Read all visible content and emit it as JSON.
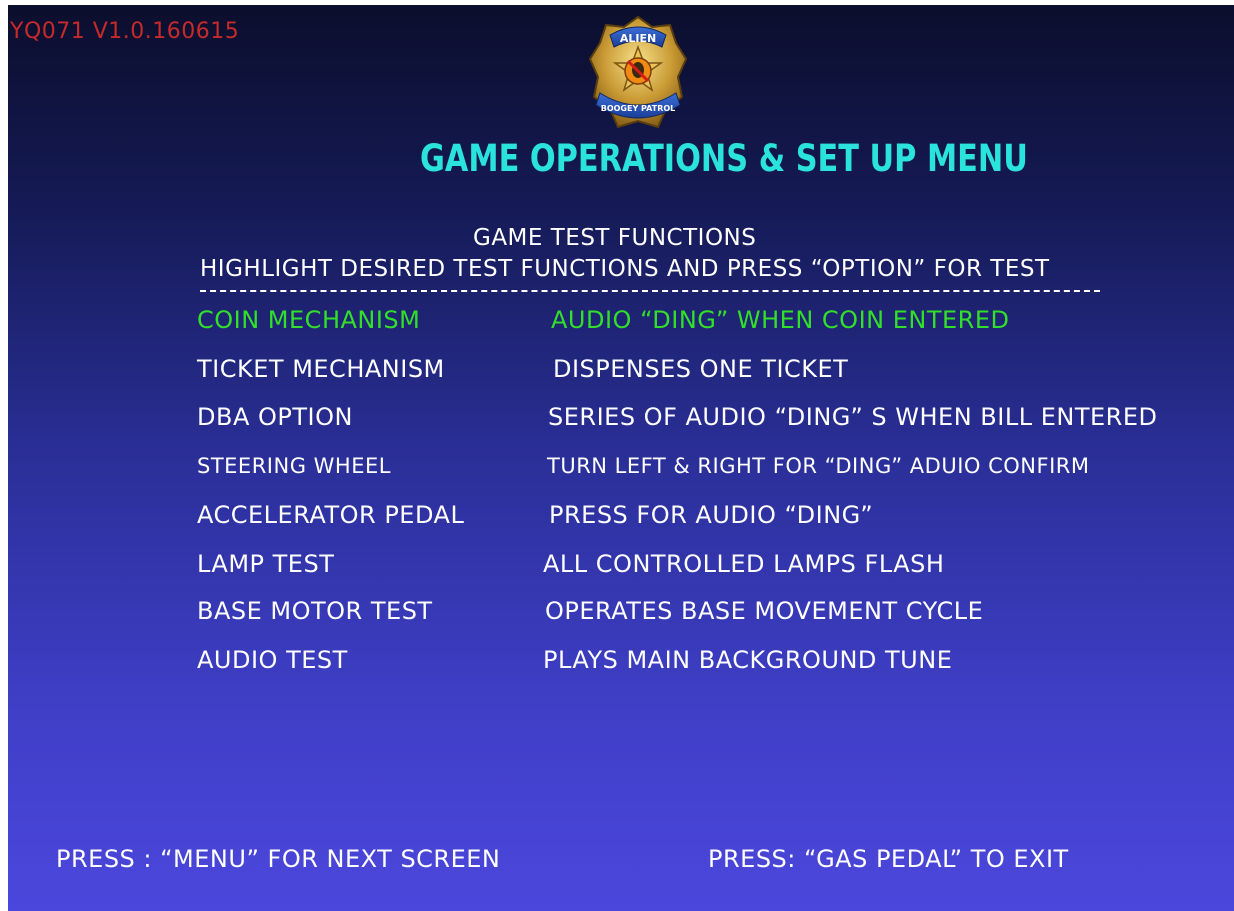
{
  "version_label": "YQ071 V1.0.160615",
  "logo": {
    "top_text": "ALIEN",
    "bottom_text": "BOOGEY PATROL"
  },
  "menu_title": "GAME OPERATIONS & SET UP MENU",
  "section_title": "GAME TEST FUNCTIONS",
  "instruction": "HIGHLIGHT DESIRED TEST FUNCTIONS AND PRESS  “OPTION” FOR TEST",
  "test_items": [
    {
      "name": "COIN MECHANISM",
      "description": "AUDIO  “DING”  WHEN COIN ENTERED"
    },
    {
      "name": "TICKET MECHANISM",
      "description": "DISPENSES ONE TICKET"
    },
    {
      "name": "DBA OPTION",
      "description": "SERIES OF AUDIO  “DING” S WHEN BILL ENTERED"
    },
    {
      "name": "STEERING WHEEL",
      "description": "TURN LEFT & RIGHT FOR “DING” ADUIO CONFIRM"
    },
    {
      "name": "ACCELERATOR PEDAL",
      "description": "PRESS FOR AUDIO  “DING”"
    },
    {
      "name": "LAMP TEST",
      "description": "ALL CONTROLLED LAMPS FLASH"
    },
    {
      "name": "BASE MOTOR TEST",
      "description": "OPERATES BASE MOVEMENT CYCLE"
    },
    {
      "name": "AUDIO TEST",
      "description": "PLAYS MAIN BACKGROUND TUNE"
    }
  ],
  "footer": {
    "left": "PRESS : “MENU” FOR NEXT SCREEN",
    "right": "PRESS: “GAS PEDAL” TO EXIT"
  },
  "colors": {
    "version": "#c62a2a",
    "title": "#29e3dc",
    "highlight": "#32e02a",
    "text": "#ffffff",
    "bg_top": "#0b0e2c",
    "bg_bottom": "#4b47dc"
  },
  "icons": {
    "logo": "police-badge-alien-logo"
  }
}
